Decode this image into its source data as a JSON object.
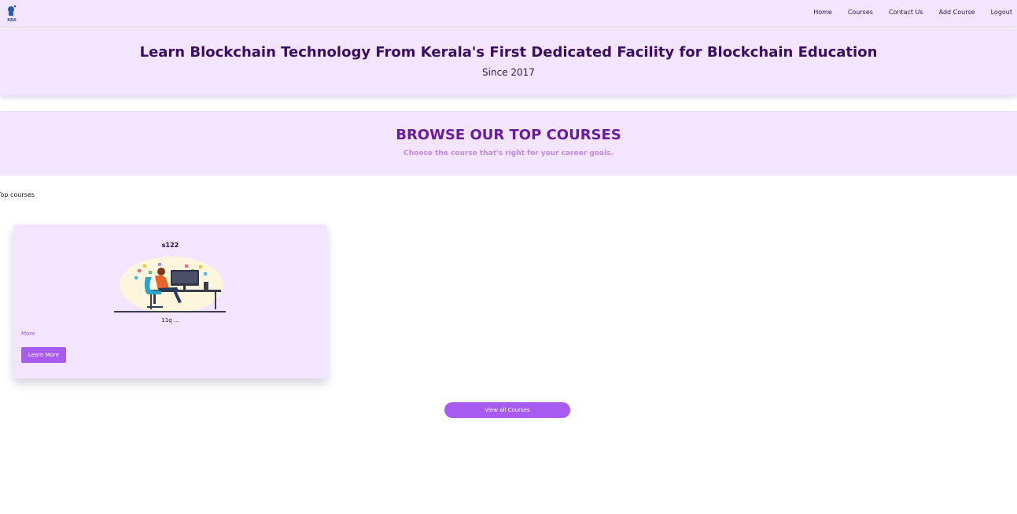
{
  "nav": {
    "logo_text": "KBA",
    "links": [
      {
        "label": "Home"
      },
      {
        "label": "Courses"
      },
      {
        "label": "Contact Us"
      },
      {
        "label": "Add Course"
      },
      {
        "label": "Logout"
      }
    ]
  },
  "hero": {
    "title": "Learn Blockchain Technology From Kerala's First Dedicated Facility for Blockchain Education",
    "subtitle": "Since 2017"
  },
  "browse": {
    "title": "BROWSE OUR TOP COURSES",
    "subtitle": "Choose the course that's right for your career goals."
  },
  "section_label": "Top courses",
  "courses": [
    {
      "title": "s122",
      "description": "11q ...",
      "more_label": "More",
      "button_label": "Learn More",
      "illustration": "person-at-computer-desk-illustration"
    }
  ],
  "view_all_label": "View all Courses",
  "colors": {
    "nav_bg": "#f3e5ff",
    "hero_title": "#3a0d63",
    "browse_title": "#6a1ca0",
    "browse_subtitle": "#c08be4",
    "accent_button": "#a75bf0",
    "link_more": "#9a5bd4"
  }
}
